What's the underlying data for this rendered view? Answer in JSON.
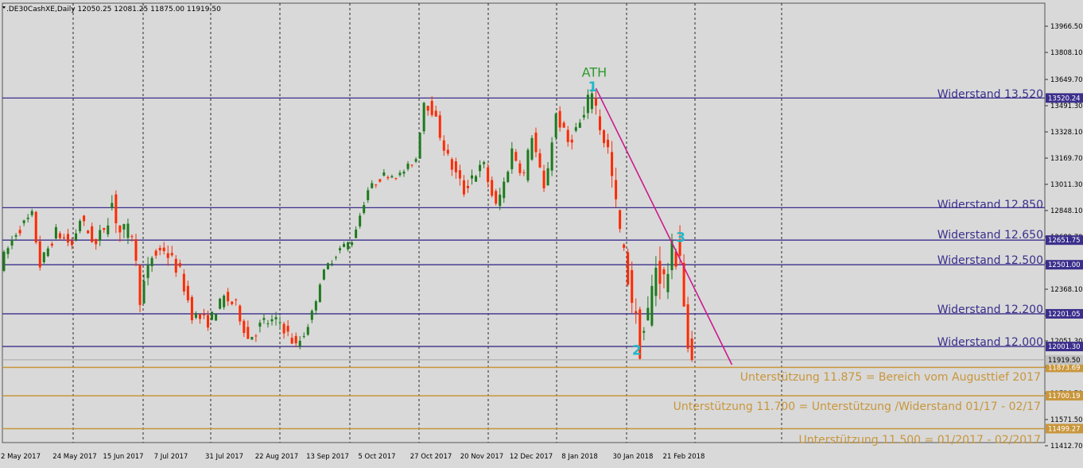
{
  "symbol_header": ".DE30CashXE,Daily  12050.25 12081.25 11875.00 11919.50",
  "colors": {
    "background": "#d9d9d9",
    "grid": "#2a2a2a",
    "candle_up": "#1d7a1d",
    "candle_down": "#ff2a00",
    "resistance": "#3a2f8c",
    "support": "#c8963c",
    "trendline": "#cc1a8c",
    "ath_label": "#2e9a2e",
    "wave_label": "#22b8c8",
    "price_box": "#3a2f8c",
    "support_box": "#c8963c",
    "current_box": "#c0c0c0"
  },
  "chart_data": {
    "type": "candlestick",
    "title": ".DE30CashXE,Daily",
    "ohlc_last": {
      "open": 12050.25,
      "high": 12081.25,
      "low": 11875.0,
      "close": 11919.5
    },
    "ylim": [
      11414.0,
      14100.0
    ],
    "y_tick_labels": [
      "13966.50",
      "13808.10",
      "13649.70",
      "13491.30",
      "13328.10",
      "13169.70",
      "13011.30",
      "12848.10",
      "12689.70",
      "12530.10",
      "12368.10",
      "12209.70",
      "12051.30",
      "11892.90",
      "11730.70",
      "11571.50",
      "11412.70"
    ],
    "x_tick_labels": [
      "2 May 2017",
      "24 May 2017",
      "15 Jun 2017",
      "7 Jul 2017",
      "31 Jul 2017",
      "22 Aug 2017",
      "13 Sep 2017",
      "5 Oct 2017",
      "27 Oct 2017",
      "20 Nov 2017",
      "12 Dec 2017",
      "8 Jan 2018",
      "30 Jan 2018",
      "21 Feb 2018"
    ],
    "resistance_levels": [
      {
        "label": "Widerstand 13.520",
        "price": 13520.24,
        "price_label": "13520.24"
      },
      {
        "label": "Widerstand 12.850",
        "price": 12850,
        "price_label": ""
      },
      {
        "label": "Widerstand 12.650",
        "price": 12651.75,
        "price_label": "12651.75"
      },
      {
        "label": "Widerstand 12.500",
        "price": 12501.0,
        "price_label": "12501.00"
      },
      {
        "label": "Widerstand 12.200",
        "price": 12201.05,
        "price_label": "12201.05"
      },
      {
        "label": "Widerstand 12.000",
        "price": 12001.3,
        "price_label": "12001.30"
      }
    ],
    "support_levels": [
      {
        "label": "Unterstützung 11.875 = Bereich vom Augusttief 2017",
        "price": 11873.69,
        "price_label": "11873.69"
      },
      {
        "label": "Unterstützung 11.700 = Unterstützung /Widerstand 01/17 - 02/17",
        "price": 11700.19,
        "price_label": "11700.19"
      },
      {
        "label": "Unterstützung 11.500 = 01/2017 - 02/2017",
        "price": 11499.27,
        "price_label": "11499.27"
      }
    ],
    "current_price": {
      "price": 11919.5,
      "label": "11919.50"
    },
    "annotations": [
      {
        "text": "ATH",
        "bar": 148,
        "price": 13650,
        "kind": "ath"
      },
      {
        "text": "1",
        "bar": 148,
        "price": 13560,
        "kind": "wave"
      },
      {
        "text": "2",
        "bar": 159,
        "price": 11950,
        "kind": "wave"
      },
      {
        "text": "3",
        "bar": 170,
        "price": 12640,
        "kind": "wave"
      }
    ],
    "trendline": {
      "from": {
        "bar": 148,
        "price": 13580
      },
      "to": {
        "bar": 182,
        "price": 11890
      }
    },
    "path_anchors": [
      [
        0,
        12500
      ],
      [
        4,
        12700
      ],
      [
        8,
        12800
      ],
      [
        10,
        12500
      ],
      [
        14,
        12700
      ],
      [
        18,
        12620
      ],
      [
        20,
        12780
      ],
      [
        24,
        12620
      ],
      [
        28,
        12880
      ],
      [
        30,
        12700
      ],
      [
        33,
        12700
      ],
      [
        35,
        12300
      ],
      [
        38,
        12550
      ],
      [
        41,
        12600
      ],
      [
        42,
        12560
      ],
      [
        45,
        12450
      ],
      [
        48,
        12200
      ],
      [
        52,
        12150
      ],
      [
        56,
        12300
      ],
      [
        59,
        12250
      ],
      [
        62,
        12050
      ],
      [
        66,
        12150
      ],
      [
        70,
        12150
      ],
      [
        74,
        12000
      ],
      [
        76,
        12080
      ],
      [
        78,
        12200
      ],
      [
        80,
        12400
      ],
      [
        82,
        12500
      ],
      [
        85,
        12600
      ],
      [
        88,
        12650
      ],
      [
        92,
        12960
      ],
      [
        96,
        13050
      ],
      [
        100,
        13050
      ],
      [
        104,
        13150
      ],
      [
        106,
        13500
      ],
      [
        108,
        13450
      ],
      [
        112,
        13150
      ],
      [
        116,
        12950
      ],
      [
        118,
        13050
      ],
      [
        121,
        13100
      ],
      [
        124,
        12850
      ],
      [
        126,
        13000
      ],
      [
        128,
        13200
      ],
      [
        131,
        13050
      ],
      [
        133,
        13300
      ],
      [
        136,
        12950
      ],
      [
        139,
        13420
      ],
      [
        142,
        13250
      ],
      [
        146,
        13400
      ],
      [
        148,
        13580
      ],
      [
        150,
        13350
      ],
      [
        152,
        13200
      ],
      [
        154,
        12850
      ],
      [
        156,
        12550
      ],
      [
        158,
        12300
      ],
      [
        160,
        12000
      ],
      [
        162,
        12200
      ],
      [
        164,
        12500
      ],
      [
        166,
        12400
      ],
      [
        168,
        12550
      ],
      [
        170,
        12590
      ],
      [
        171,
        12250
      ],
      [
        172,
        11920
      ]
    ],
    "trend_amplitude": [
      [
        0,
        60
      ],
      [
        24,
        60
      ],
      [
        25,
        130
      ],
      [
        33,
        80
      ],
      [
        42,
        80
      ],
      [
        52,
        55
      ],
      [
        65,
        70
      ],
      [
        80,
        45
      ],
      [
        90,
        35
      ],
      [
        104,
        35
      ],
      [
        106,
        60
      ],
      [
        113,
        75
      ],
      [
        126,
        75
      ],
      [
        140,
        60
      ],
      [
        150,
        120
      ],
      [
        172,
        180
      ]
    ],
    "bar_count": 173
  }
}
